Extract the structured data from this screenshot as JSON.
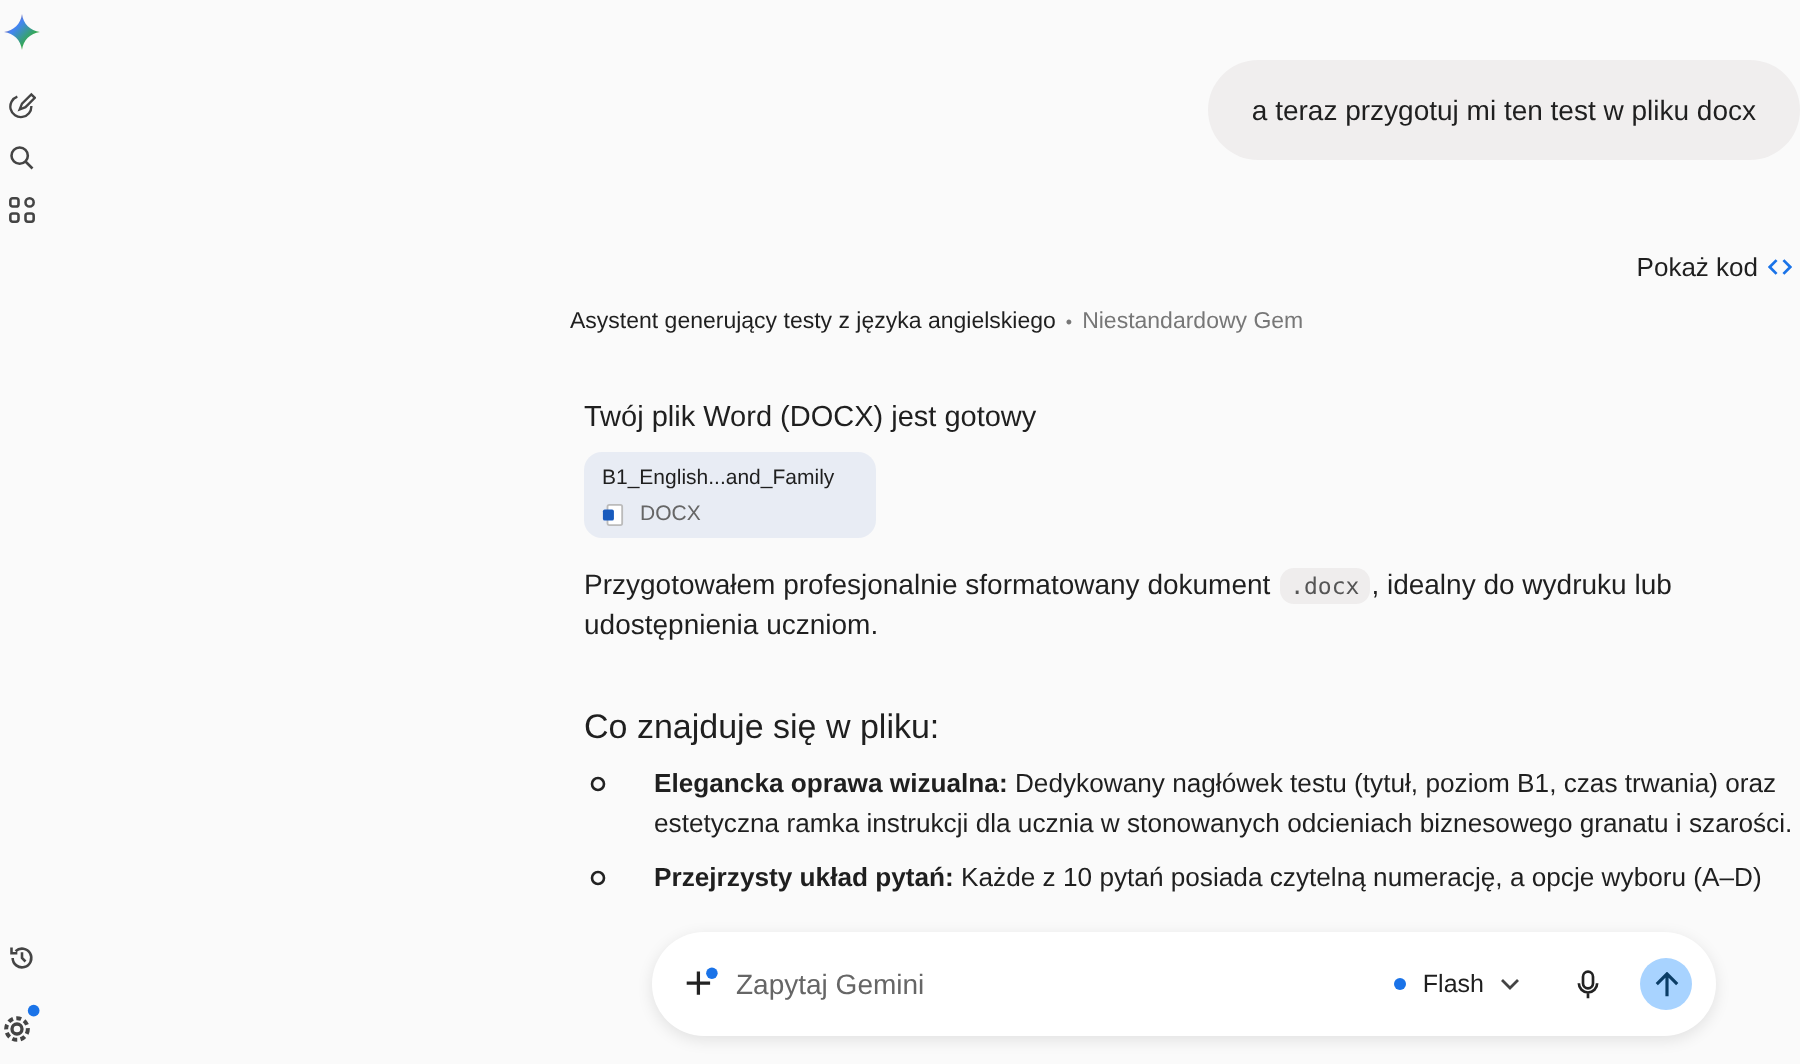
{
  "user_message": "a teraz przygotuj mi ten test w pliku docx",
  "show_code": "Pokaż kod",
  "gem": {
    "name": "Asystent generujący testy z języka angielskiego",
    "separator": "•",
    "type": "Niestandardowy Gem"
  },
  "response": {
    "heading": "Twój plik Word (DOCX) jest gotowy",
    "file": {
      "name": "B1_English...and_Family",
      "type": "DOCX"
    },
    "paragraph": {
      "before": "Przygotowałem profesjonalnie sformatowany dokument ",
      "code": ".docx",
      "after": ", idealny do wydruku lub udostępnienia uczniom."
    },
    "section_title": "Co znajduje się w pliku:",
    "bullets": [
      {
        "text": "**Elegancka oprawa wizualna:** Dedykowany nagłówek testu (tytuł, poziom B1, czas trwania) oraz estetyczna ramka instrukcji dla ucznia w stonowanych odcieniach biznesowego granatu i szarości."
      },
      {
        "text": "**Przejrzysty układ pytań:** Każde z 10 pytań posiada czytelną numerację, a opcje wyboru (A–D)"
      }
    ]
  },
  "input": {
    "placeholder": "Zapytaj Gemini",
    "model": "Flash"
  }
}
